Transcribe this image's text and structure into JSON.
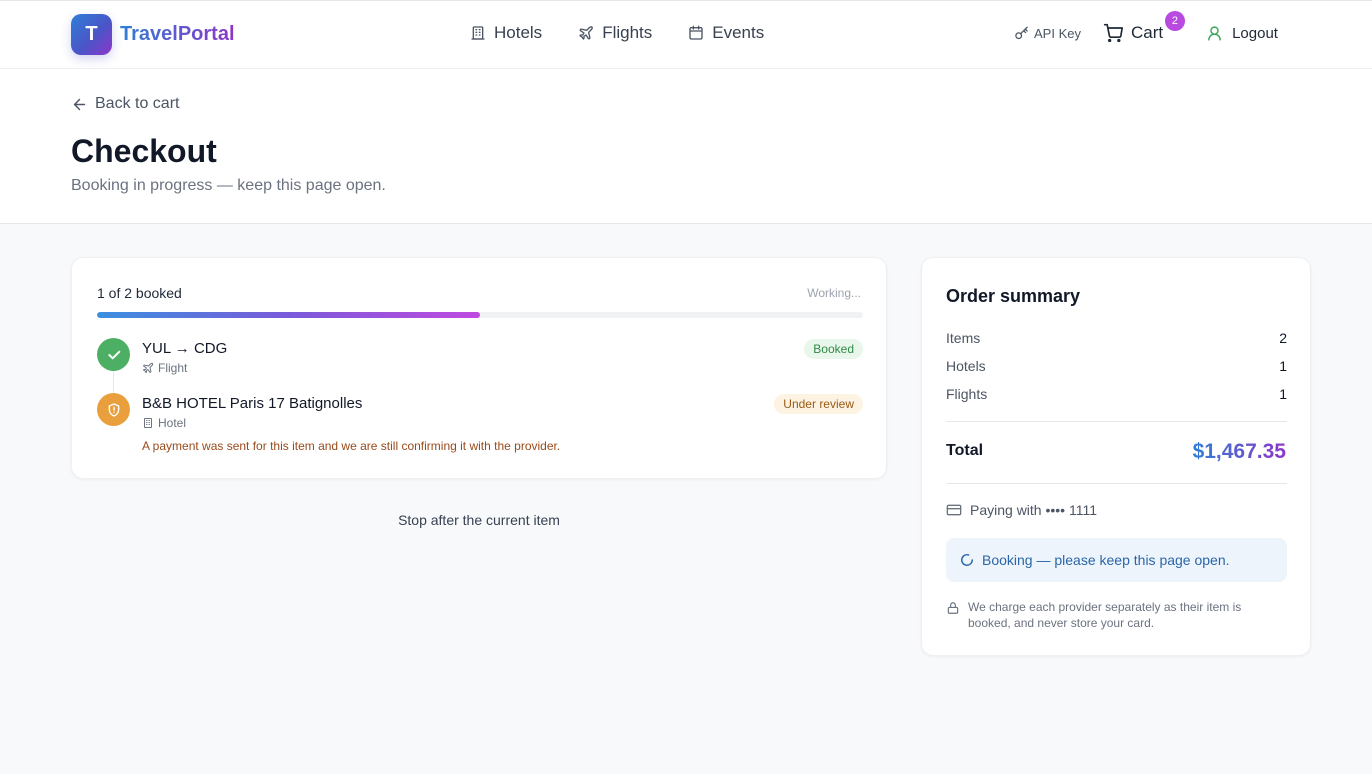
{
  "brand": {
    "initial": "T",
    "name": "TravelPortal"
  },
  "nav": {
    "hotels": "Hotels",
    "flights": "Flights",
    "events": "Events",
    "api_key": "API Key",
    "cart": "Cart",
    "cart_count": "2",
    "logout": "Logout"
  },
  "page": {
    "back": "Back to cart",
    "title": "Checkout",
    "subtitle": "Booking in progress — keep this page open."
  },
  "progress": {
    "label": "1 of 2 booked",
    "status": "Working...",
    "fraction": 0.5,
    "items": [
      {
        "name": "YUL → CDG",
        "type": "Flight",
        "badge": "Booked",
        "state": "success",
        "icon": "check-icon"
      },
      {
        "name": "B&B HOTEL Paris 17 Batignolles",
        "type": "Hotel",
        "badge": "Under review",
        "state": "warning",
        "icon": "shield-icon",
        "note": "A payment was sent for this item and we are still confirming it with the provider."
      }
    ]
  },
  "stop_label": "Stop after the current item",
  "summary": {
    "title": "Order summary",
    "rows": [
      {
        "label": "Items",
        "value": "2"
      },
      {
        "label": "Hotels",
        "value": "1"
      },
      {
        "label": "Flights",
        "value": "1"
      }
    ],
    "total_label": "Total",
    "total_value": "$1,467.35",
    "paying": "Paying with •••• 1111",
    "booking_status": "Booking — please keep this page open.",
    "security_note": "We charge each provider separately as their item is booked, and never store your card."
  },
  "colors": {
    "accent_start": "#2f7fd6",
    "accent_end": "#8d36c9",
    "success": "#4caf63",
    "warning": "#e89f3c"
  }
}
